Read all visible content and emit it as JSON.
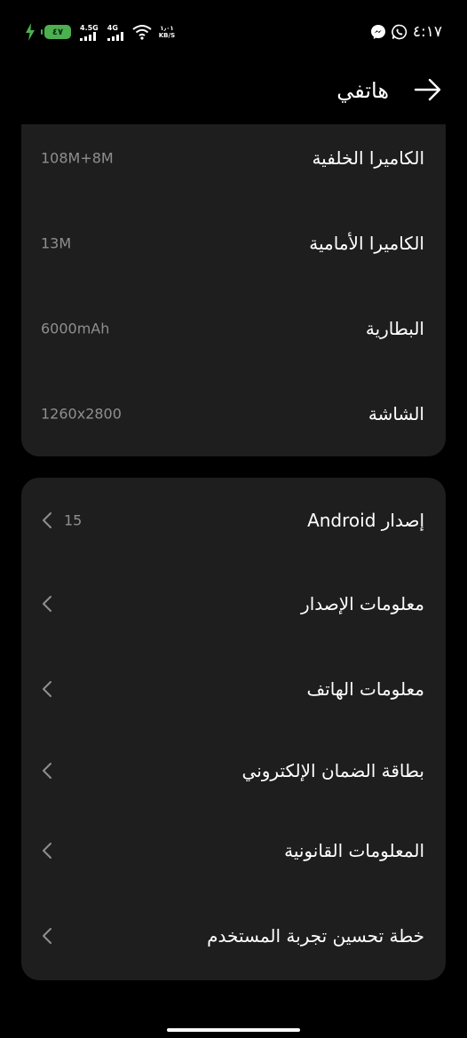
{
  "status_bar": {
    "battery_level": "٤٧",
    "network_1_label": "4.5G",
    "network_2_label": "4G",
    "speed_value": "١٫٠١",
    "speed_unit": "KB/S",
    "time": "٤:١٧",
    "icons": [
      "charging-bolt-icon",
      "battery-icon",
      "signal-icon",
      "wifi-icon",
      "whatsapp-icon",
      "messenger-icon"
    ],
    "battery_color": "#4caf50"
  },
  "header": {
    "title": "هاتفي",
    "back_icon": "arrow-right-icon"
  },
  "specs": {
    "items": [
      {
        "label": "الكاميرا الخلفية",
        "value": "108M+8M"
      },
      {
        "label": "الكاميرا الأمامية",
        "value": "13M"
      },
      {
        "label": "البطارية",
        "value": "6000mAh"
      },
      {
        "label": "الشاشة",
        "value": "1260x2800"
      }
    ]
  },
  "info": {
    "items": [
      {
        "label": "إصدار Android",
        "value": "15"
      },
      {
        "label": "معلومات الإصدار"
      },
      {
        "label": "معلومات الهاتف"
      },
      {
        "label": "بطاقة الضمان الإلكتروني"
      },
      {
        "label": "المعلومات القانونية"
      },
      {
        "label": "خطة تحسين تجربة المستخدم"
      }
    ]
  },
  "colors": {
    "background": "#000000",
    "card": "#1e1e1e",
    "secondary_text": "#8f8f8f"
  }
}
